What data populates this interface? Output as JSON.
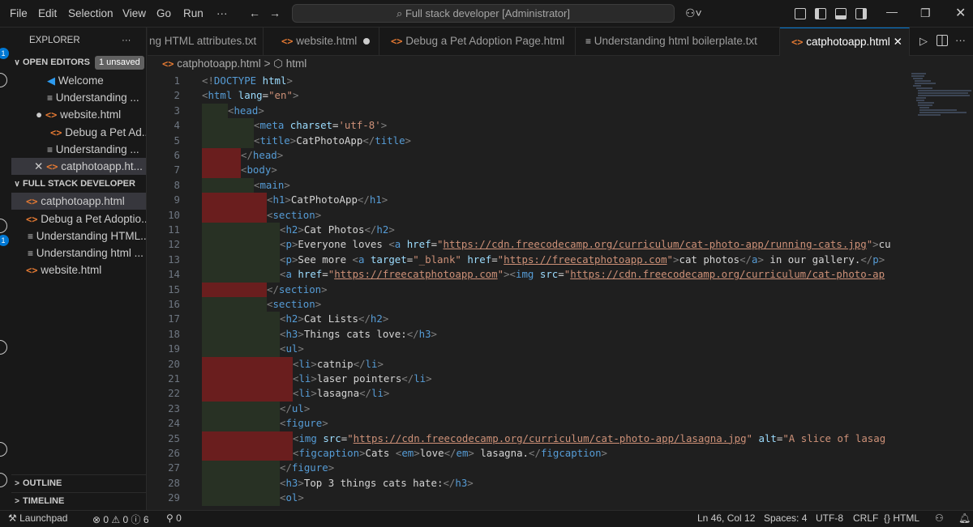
{
  "menu": [
    "File",
    "Edit",
    "Selection",
    "View",
    "Go",
    "Run",
    "···"
  ],
  "command_center": "Full stack developer [Administrator]",
  "explorer": {
    "title": "EXPLORER",
    "more": "···",
    "open_editors": {
      "label": "OPEN EDITORS",
      "badge": "1 unsaved",
      "items": [
        {
          "icon": "vscode-icon",
          "label": "Welcome"
        },
        {
          "icon": "text-file-icon",
          "label": "Understanding ..."
        },
        {
          "icon": "html-file-icon",
          "label": "website.html",
          "dirty": true
        },
        {
          "icon": "html-file-icon",
          "label": "Debug a Pet Ad..."
        },
        {
          "icon": "text-file-icon",
          "label": "Understanding ..."
        },
        {
          "icon": "html-file-icon",
          "label": "catphotoapp.ht...",
          "close": true
        }
      ]
    },
    "folder": {
      "label": "FULL STACK DEVELOPER",
      "items": [
        {
          "icon": "html-file-icon",
          "label": "catphotoapp.html",
          "selected": true
        },
        {
          "icon": "html-file-icon",
          "label": "Debug a Pet Adoptio..."
        },
        {
          "icon": "text-file-icon",
          "label": "Understanding HTML..."
        },
        {
          "icon": "text-file-icon",
          "label": "Understanding html ..."
        },
        {
          "icon": "html-file-icon",
          "label": "website.html"
        }
      ]
    },
    "outline": "OUTLINE",
    "timeline": "TIMELINE"
  },
  "tabs": [
    {
      "icon": "",
      "label": "ng HTML attributes.txt"
    },
    {
      "icon": "<>",
      "label": "website.html",
      "dirty": true
    },
    {
      "icon": "<>",
      "label": "Debug a Pet Adoption Page.html"
    },
    {
      "icon": "≡",
      "label": "Understanding html boilerplate.txt"
    },
    {
      "icon": "<>",
      "label": "catphotoapp.html",
      "active": true
    }
  ],
  "breadcrumb": {
    "file": "catphotoapp.html",
    "sep": ">",
    "symbol": "html"
  },
  "code_lines": [
    {
      "n": "1",
      "html": "<span class=\"p\">&lt;!</span><span class=\"t\">DOCTYPE</span> <span class=\"a\">html</span><span class=\"p\">&gt;</span>"
    },
    {
      "n": "2",
      "html": "<span class=\"p\">&lt;</span><span class=\"t\">html</span> <span class=\"a\">lang</span><span class=\"x\">=</span><span class=\"s\">\"en\"</span><span class=\"p\">&gt;</span>"
    },
    {
      "n": "3",
      "html": "<span class=\"g gg\"></span><span class=\"g gg\"></span><span class=\"p\">&lt;</span><span class=\"t\">head</span><span class=\"p\">&gt;</span>"
    },
    {
      "n": "4",
      "html": "<span class=\"g gg\"></span><span class=\"g gg\"></span><span class=\"g gg\"></span><span class=\"g gg\"></span><span class=\"p\">&lt;</span><span class=\"t\">meta</span> <span class=\"a\">charset</span><span class=\"x\">=</span><span class=\"s\">'utf-8'</span><span class=\"p\">&gt;</span>"
    },
    {
      "n": "5",
      "html": "<span class=\"g gg\"></span><span class=\"g gg\"></span><span class=\"g gg\"></span><span class=\"g gg\"></span><span class=\"p\">&lt;</span><span class=\"t\">title</span><span class=\"p\">&gt;</span><span class=\"x\">CatPhotoApp</span><span class=\"p\">&lt;/</span><span class=\"t\">title</span><span class=\"p\">&gt;</span>"
    },
    {
      "n": "6",
      "html": "<span class=\"g gr\"></span><span class=\"g gr\"></span><span class=\"g gr\"></span><span class=\"p\">&lt;/</span><span class=\"t\">head</span><span class=\"p\">&gt;</span>"
    },
    {
      "n": "7",
      "html": "<span class=\"g gr\"></span><span class=\"g gr\"></span><span class=\"g gr\"></span><span class=\"p\">&lt;</span><span class=\"t\">body</span><span class=\"p\">&gt;</span>"
    },
    {
      "n": "8",
      "html": "<span class=\"g gg\"></span><span class=\"g gg\"></span><span class=\"g gg\"></span><span class=\"g gg\"></span><span class=\"p\">&lt;</span><span class=\"t\">main</span><span class=\"p\">&gt;</span>"
    },
    {
      "n": "9",
      "html": "<span class=\"g gr\"></span><span class=\"g gr\"></span><span class=\"g gr\"></span><span class=\"g gr\"></span><span class=\"g gr\"></span><span class=\"p\">&lt;</span><span class=\"t\">h1</span><span class=\"p\">&gt;</span><span class=\"x\">CatPhotoApp</span><span class=\"p\">&lt;/</span><span class=\"t\">h1</span><span class=\"p\">&gt;</span>"
    },
    {
      "n": "10",
      "html": "<span class=\"g gr\"></span><span class=\"g gr\"></span><span class=\"g gr\"></span><span class=\"g gr\"></span><span class=\"g gr\"></span><span class=\"p\">&lt;</span><span class=\"t\">section</span><span class=\"p\">&gt;</span>"
    },
    {
      "n": "11",
      "html": "<span class=\"g gg\"></span><span class=\"g gg\"></span><span class=\"g gg\"></span><span class=\"g gg\"></span><span class=\"g gg\"></span><span class=\"g gg\"></span><span class=\"p\">&lt;</span><span class=\"t\">h2</span><span class=\"p\">&gt;</span><span class=\"x\">Cat Photos</span><span class=\"p\">&lt;/</span><span class=\"t\">h2</span><span class=\"p\">&gt;</span>"
    },
    {
      "n": "12",
      "html": "<span class=\"g gg\"></span><span class=\"g gg\"></span><span class=\"g gg\"></span><span class=\"g gg\"></span><span class=\"g gg\"></span><span class=\"g gg\"></span><span class=\"p\">&lt;</span><span class=\"t\">p</span><span class=\"p\">&gt;</span><span class=\"x\">Everyone loves </span><span class=\"p\">&lt;</span><span class=\"t\">a</span> <span class=\"a\">href</span><span class=\"x\">=</span><span class=\"s\">\"</span><span class=\"u\">https://cdn.freecodecamp.org/curriculum/cat-photo-app/running-cats.jpg</span><span class=\"s\">\"</span><span class=\"p\">&gt;</span><span class=\"x\">cu</span>"
    },
    {
      "n": "13",
      "html": "<span class=\"g gg\"></span><span class=\"g gg\"></span><span class=\"g gg\"></span><span class=\"g gg\"></span><span class=\"g gg\"></span><span class=\"g gg\"></span><span class=\"p\">&lt;</span><span class=\"t\">p</span><span class=\"p\">&gt;</span><span class=\"x\">See more </span><span class=\"p\">&lt;</span><span class=\"t\">a</span> <span class=\"a\">target</span><span class=\"x\">=</span><span class=\"s\">\"_blank\"</span> <span class=\"a\">href</span><span class=\"x\">=</span><span class=\"s\">\"</span><span class=\"u\">https://freecatphotoapp.com</span><span class=\"s\">\"</span><span class=\"p\">&gt;</span><span class=\"x\">cat photos</span><span class=\"p\">&lt;/</span><span class=\"t\">a</span><span class=\"p\">&gt;</span><span class=\"x\"> in our gallery.</span><span class=\"p\">&lt;/</span><span class=\"t\">p</span><span class=\"p\">&gt;</span>"
    },
    {
      "n": "14",
      "html": "<span class=\"g gg\"></span><span class=\"g gg\"></span><span class=\"g gg\"></span><span class=\"g gg\"></span><span class=\"g gg\"></span><span class=\"g gg\"></span><span class=\"p\">&lt;</span><span class=\"t\">a</span> <span class=\"a\">href</span><span class=\"x\">=</span><span class=\"s\">\"</span><span class=\"u\">https://freecatphotoapp.com</span><span class=\"s\">\"</span><span class=\"p\">&gt;&lt;</span><span class=\"t\">img</span> <span class=\"a\">src</span><span class=\"x\">=</span><span class=\"s\">\"</span><span class=\"u\">https://cdn.freecodecamp.org/curriculum/cat-photo-ap</span>"
    },
    {
      "n": "15",
      "html": "<span class=\"g gr\"></span><span class=\"g gr\"></span><span class=\"g gr\"></span><span class=\"g gr\"></span><span class=\"g gr\"></span><span class=\"p\">&lt;/</span><span class=\"t\">section</span><span class=\"p\">&gt;</span>"
    },
    {
      "n": "16",
      "html": "<span class=\"g gg\"></span><span class=\"g gg\"></span><span class=\"g gg\"></span><span class=\"g gg\"></span><span class=\"g gg\"></span><span class=\"p\">&lt;</span><span class=\"t\">section</span><span class=\"p\">&gt;</span>"
    },
    {
      "n": "17",
      "html": "<span class=\"g gg\"></span><span class=\"g gg\"></span><span class=\"g gg\"></span><span class=\"g gg\"></span><span class=\"g gg\"></span><span class=\"g gg\"></span><span class=\"p\">&lt;</span><span class=\"t\">h2</span><span class=\"p\">&gt;</span><span class=\"x\">Cat Lists</span><span class=\"p\">&lt;/</span><span class=\"t\">h2</span><span class=\"p\">&gt;</span>"
    },
    {
      "n": "18",
      "html": "<span class=\"g gg\"></span><span class=\"g gg\"></span><span class=\"g gg\"></span><span class=\"g gg\"></span><span class=\"g gg\"></span><span class=\"g gg\"></span><span class=\"p\">&lt;</span><span class=\"t\">h3</span><span class=\"p\">&gt;</span><span class=\"x\">Things cats love:</span><span class=\"p\">&lt;/</span><span class=\"t\">h3</span><span class=\"p\">&gt;</span>"
    },
    {
      "n": "19",
      "html": "<span class=\"g gg\"></span><span class=\"g gg\"></span><span class=\"g gg\"></span><span class=\"g gg\"></span><span class=\"g gg\"></span><span class=\"g gg\"></span><span class=\"p\">&lt;</span><span class=\"t\">ul</span><span class=\"p\">&gt;</span>"
    },
    {
      "n": "20",
      "html": "<span class=\"g gr\"></span><span class=\"g gr\"></span><span class=\"g gr\"></span><span class=\"g gr\"></span><span class=\"g gr\"></span><span class=\"g gr\"></span><span class=\"g gr\"></span><span class=\"p\">&lt;</span><span class=\"t\">li</span><span class=\"p\">&gt;</span><span class=\"x\">catnip</span><span class=\"p\">&lt;/</span><span class=\"t\">li</span><span class=\"p\">&gt;</span>"
    },
    {
      "n": "21",
      "html": "<span class=\"g gr\"></span><span class=\"g gr\"></span><span class=\"g gr\"></span><span class=\"g gr\"></span><span class=\"g gr\"></span><span class=\"g gr\"></span><span class=\"g gr\"></span><span class=\"p\">&lt;</span><span class=\"t\">li</span><span class=\"p\">&gt;</span><span class=\"x\">laser pointers</span><span class=\"p\">&lt;/</span><span class=\"t\">li</span><span class=\"p\">&gt;</span>"
    },
    {
      "n": "22",
      "html": "<span class=\"g gr\"></span><span class=\"g gr\"></span><span class=\"g gr\"></span><span class=\"g gr\"></span><span class=\"g gr\"></span><span class=\"g gr\"></span><span class=\"g gr\"></span><span class=\"p\">&lt;</span><span class=\"t\">li</span><span class=\"p\">&gt;</span><span class=\"x\">lasagna</span><span class=\"p\">&lt;/</span><span class=\"t\">li</span><span class=\"p\">&gt;</span>"
    },
    {
      "n": "23",
      "html": "<span class=\"g gg\"></span><span class=\"g gg\"></span><span class=\"g gg\"></span><span class=\"g gg\"></span><span class=\"g gg\"></span><span class=\"g gg\"></span><span class=\"p\">&lt;/</span><span class=\"t\">ul</span><span class=\"p\">&gt;</span>"
    },
    {
      "n": "24",
      "html": "<span class=\"g gg\"></span><span class=\"g gg\"></span><span class=\"g gg\"></span><span class=\"g gg\"></span><span class=\"g gg\"></span><span class=\"g gg\"></span><span class=\"p\">&lt;</span><span class=\"t\">figure</span><span class=\"p\">&gt;</span>"
    },
    {
      "n": "25",
      "html": "<span class=\"g gr\"></span><span class=\"g gr\"></span><span class=\"g gr\"></span><span class=\"g gr\"></span><span class=\"g gr\"></span><span class=\"g gr\"></span><span class=\"g gr\"></span><span class=\"p\">&lt;</span><span class=\"t\">img</span> <span class=\"a\">src</span><span class=\"x\">=</span><span class=\"s\">\"</span><span class=\"u\">https://cdn.freecodecamp.org/curriculum/cat-photo-app/lasagna.jpg</span><span class=\"s\">\"</span> <span class=\"a\">alt</span><span class=\"x\">=</span><span class=\"s\">\"A slice of lasag</span>"
    },
    {
      "n": "26",
      "html": "<span class=\"g gr\"></span><span class=\"g gr\"></span><span class=\"g gr\"></span><span class=\"g gr\"></span><span class=\"g gr\"></span><span class=\"g gr\"></span><span class=\"g gr\"></span><span class=\"p\">&lt;</span><span class=\"t\">figcaption</span><span class=\"p\">&gt;</span><span class=\"x\">Cats </span><span class=\"p\">&lt;</span><span class=\"t\">em</span><span class=\"p\">&gt;</span><span class=\"x\">love</span><span class=\"p\">&lt;/</span><span class=\"t\">em</span><span class=\"p\">&gt;</span><span class=\"x\"> lasagna.</span><span class=\"p\">&lt;/</span><span class=\"t\">figcaption</span><span class=\"p\">&gt;</span>"
    },
    {
      "n": "27",
      "html": "<span class=\"g gg\"></span><span class=\"g gg\"></span><span class=\"g gg\"></span><span class=\"g gg\"></span><span class=\"g gg\"></span><span class=\"g gg\"></span><span class=\"p\">&lt;/</span><span class=\"t\">figure</span><span class=\"p\">&gt;</span>"
    },
    {
      "n": "28",
      "html": "<span class=\"g gg\"></span><span class=\"g gg\"></span><span class=\"g gg\"></span><span class=\"g gg\"></span><span class=\"g gg\"></span><span class=\"g gg\"></span><span class=\"p\">&lt;</span><span class=\"t\">h3</span><span class=\"p\">&gt;</span><span class=\"x\">Top 3 things cats hate:</span><span class=\"p\">&lt;/</span><span class=\"t\">h3</span><span class=\"p\">&gt;</span>"
    },
    {
      "n": "29",
      "html": "<span class=\"g gg\"></span><span class=\"g gg\"></span><span class=\"g gg\"></span><span class=\"g gg\"></span><span class=\"g gg\"></span><span class=\"g gg\"></span><span class=\"p\">&lt;</span><span class=\"t\">ol</span><span class=\"p\">&gt;</span>"
    }
  ],
  "status": {
    "launchpad": "Launchpad",
    "problems": "⊗ 0 ⚠ 0 ⓘ 6",
    "ports": "0",
    "cursor": "Ln 46, Col 12",
    "spaces": "Spaces: 4",
    "encoding": "UTF-8",
    "eol": "CRLF",
    "language": "HTML"
  },
  "colors": {
    "accent": "#0078d4",
    "added": "#283124",
    "removed": "#6a1e1e",
    "html_icon": "#e37933"
  }
}
